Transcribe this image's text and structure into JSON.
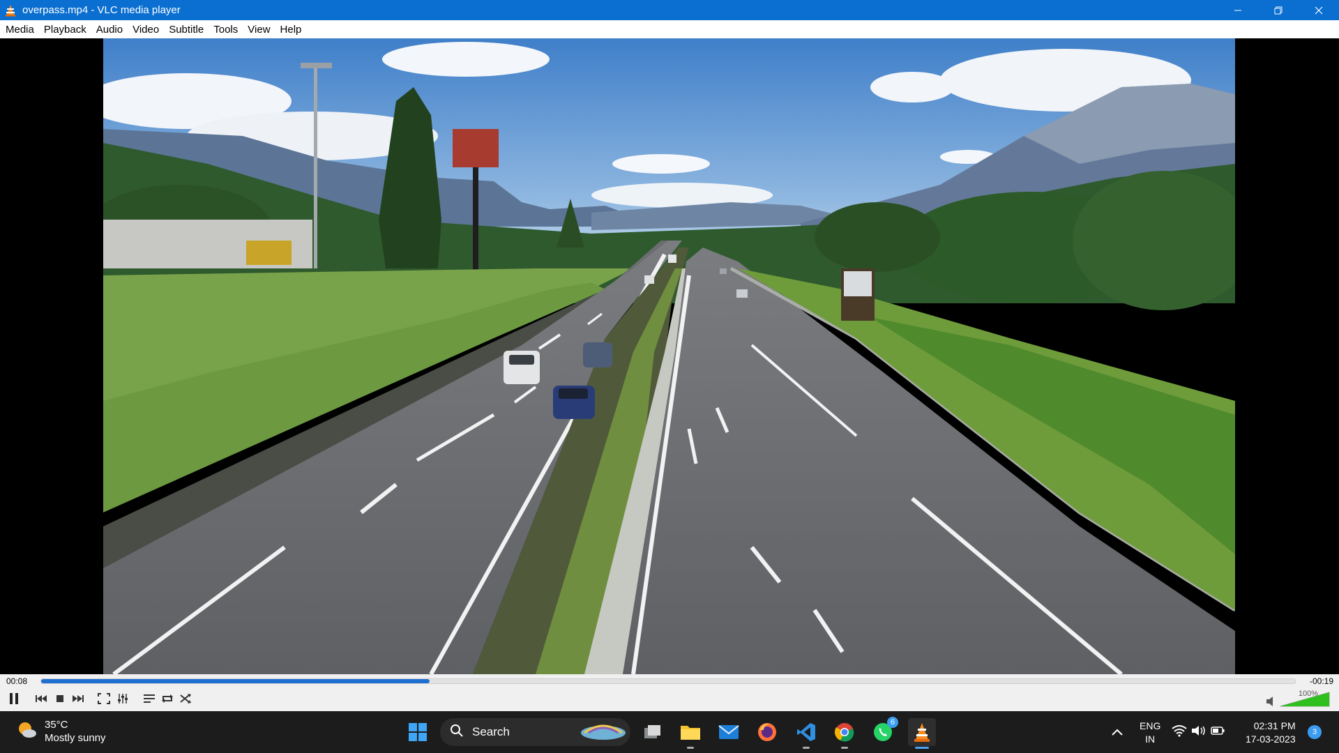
{
  "window": {
    "title": "overpass.mp4 - VLC media player"
  },
  "menu": [
    "Media",
    "Playback",
    "Audio",
    "Video",
    "Subtitle",
    "Tools",
    "View",
    "Help"
  ],
  "player": {
    "elapsed": "00:08",
    "remaining": "-00:19",
    "progress": 0.31,
    "volume_label": "100%",
    "volume_level": 1.0
  },
  "taskbar": {
    "weather_temp": "35°C",
    "weather_desc": "Mostly sunny",
    "search_label": "Search",
    "whatsapp_badge": "6",
    "lang_primary": "ENG",
    "lang_secondary": "IN",
    "time": "02:31 PM",
    "date": "17-03-2023",
    "notification_count": "3"
  },
  "colors": {
    "titlebar": "#0a6fd1",
    "seek_fill": "#1f6fd1",
    "taskbar": "#1c1c1c"
  }
}
